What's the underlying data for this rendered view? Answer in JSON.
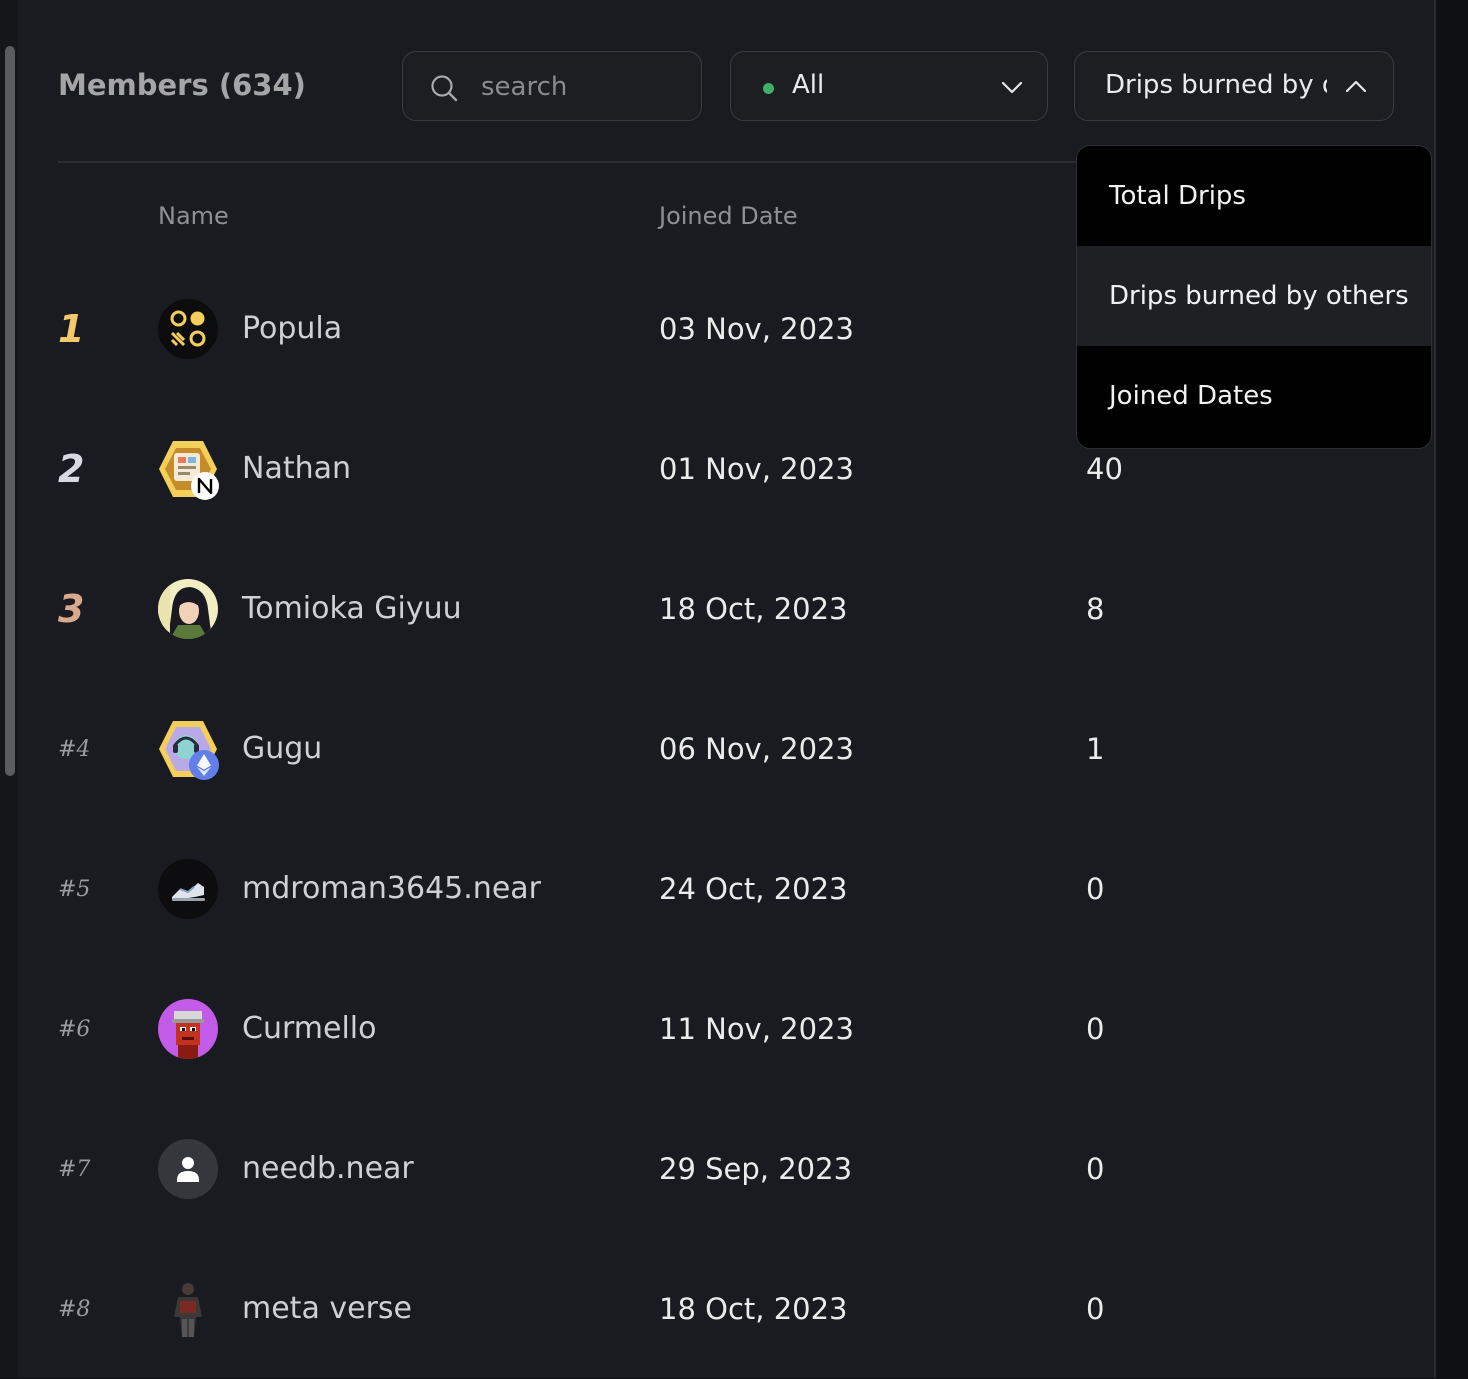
{
  "header": {
    "title": "Members (634)",
    "search_placeholder": "search",
    "filter": {
      "value": "All",
      "status_color": "#3fae66"
    },
    "sort": {
      "value": "Drips burned by o"
    }
  },
  "table": {
    "columns": [
      "Name",
      "Joined Date"
    ],
    "rows": [
      {
        "rank": "1",
        "name": "Popula",
        "joined": "03 Nov, 2023",
        "drips": "",
        "avatar": "popula-logo-avatar"
      },
      {
        "rank": "2",
        "name": "Nathan",
        "joined": "01 Nov, 2023",
        "drips": "40",
        "avatar": "hexagon-near-avatar"
      },
      {
        "rank": "3",
        "name": "Tomioka Giyuu",
        "joined": "18 Oct, 2023",
        "drips": "8",
        "avatar": "anime-character-avatar"
      },
      {
        "rank": "#4",
        "name": "Gugu",
        "joined": "06 Nov, 2023",
        "drips": "1",
        "avatar": "hexagon-eth-avatar"
      },
      {
        "rank": "#5",
        "name": "mdroman3645.near",
        "joined": "24 Oct, 2023",
        "drips": "0",
        "avatar": "sneaker-avatar"
      },
      {
        "rank": "#6",
        "name": "Curmello",
        "joined": "11 Nov, 2023",
        "drips": "0",
        "avatar": "pixel-character-avatar"
      },
      {
        "rank": "#7",
        "name": "needb.near",
        "joined": "29 Sep, 2023",
        "drips": "0",
        "avatar": "default-user-avatar"
      },
      {
        "rank": "#8",
        "name": "meta verse",
        "joined": "18 Oct, 2023",
        "drips": "0",
        "avatar": "warrior-figure-avatar"
      }
    ]
  },
  "sort_menu": {
    "options": [
      "Total Drips",
      "Drips burned by others",
      "Joined Dates"
    ],
    "selected": "Drips burned by others"
  },
  "colors": {
    "rank_gold": "#f5c86b",
    "rank_silver": "#d7dae0",
    "rank_bronze": "#d9a98c",
    "avatar_hex_yellow": "#f4cf5a",
    "avatar_purple": "#c15be8",
    "eth_blue": "#627eea"
  }
}
